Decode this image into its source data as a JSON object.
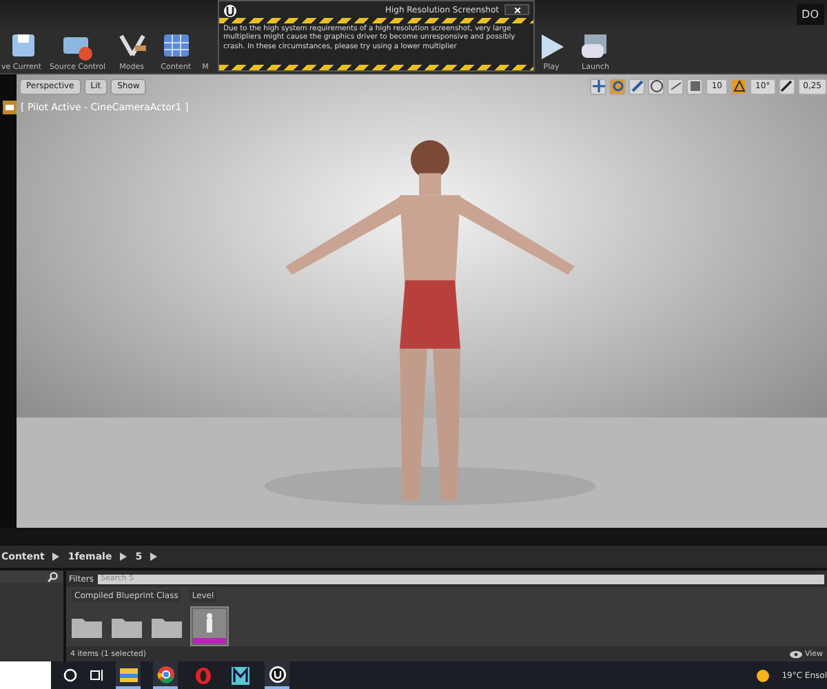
{
  "title_bar": {
    "tab": "DO"
  },
  "toolbar": {
    "buttons": [
      {
        "label": "ve Current",
        "kind": "save"
      },
      {
        "label": "Source Control",
        "kind": "source"
      },
      {
        "label": "Modes",
        "kind": "modes"
      },
      {
        "label": "Content",
        "kind": "content"
      },
      {
        "label": "M",
        "kind": "market"
      }
    ],
    "play": [
      {
        "label": "Play",
        "kind": "play"
      },
      {
        "label": "Launch",
        "kind": "launch"
      }
    ]
  },
  "dialog": {
    "title": "High Resolution Screenshot",
    "message": "Due to the high system requirements of a high resolution screenshot, very large multipliers might cause the graphics driver to become unresponsive and possibly crash. In these circumstances, please try using a lower multiplier"
  },
  "viewport": {
    "buttons": [
      "Perspective",
      "Lit",
      "Show"
    ],
    "pilot": "[ Pilot Active - CineCameraActor1 ]",
    "tools": [
      {
        "kind": "move",
        "selected": false
      },
      {
        "kind": "rotate",
        "selected": true
      },
      {
        "kind": "scale",
        "selected": false
      },
      {
        "kind": "globe",
        "selected": false
      },
      {
        "kind": "surface",
        "selected": false
      },
      {
        "kind": "grid",
        "selected": false
      },
      {
        "kind": "value",
        "text": "10",
        "selected": false
      },
      {
        "kind": "angle",
        "selected": true
      },
      {
        "kind": "value",
        "text": "10°",
        "selected": false
      },
      {
        "kind": "scalesnap",
        "selected": false
      },
      {
        "kind": "value",
        "text": "0,25",
        "selected": false
      }
    ]
  },
  "breadcrumb": [
    "Content",
    "1female",
    "5"
  ],
  "content_browser": {
    "filters": "Filters",
    "search_placeholder": "Search 5",
    "columns": [
      "Compiled Blueprint Class",
      "Level"
    ],
    "assets": [
      {
        "kind": "folder",
        "selected": false
      },
      {
        "kind": "folder",
        "selected": false
      },
      {
        "kind": "folder",
        "selected": false
      },
      {
        "kind": "level",
        "selected": true
      }
    ],
    "status": "4 items (1 selected)",
    "view": "View"
  },
  "taskbar": {
    "apps": [
      {
        "kind": "files",
        "active": true
      },
      {
        "kind": "chrome",
        "active": true
      },
      {
        "kind": "opera",
        "active": false
      },
      {
        "kind": "m",
        "active": false
      },
      {
        "kind": "unreal",
        "active": true
      }
    ],
    "weather": "19°C  Ensol"
  }
}
